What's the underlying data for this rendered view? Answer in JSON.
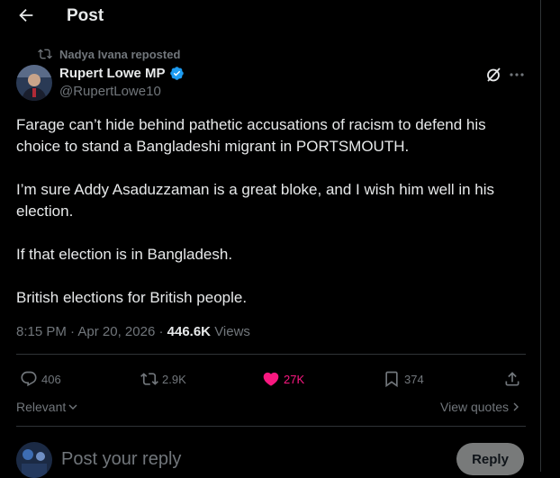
{
  "header": {
    "title": "Post"
  },
  "repost": {
    "text": "Nadya Ivana reposted"
  },
  "author": {
    "name": "Rupert Lowe MP",
    "handle": "@RupertLowe10"
  },
  "tweet": {
    "paragraphs": [
      "Farage can’t hide behind pathetic accusations of racism to defend his choice to stand a Bangladeshi migrant in PORTSMOUTH.",
      "I’m sure Addy Asaduzzaman is a great bloke, and I wish him well in his election.",
      "If that election is in Bangladesh.",
      "British elections for British people."
    ],
    "time": "8:15 PM",
    "date": "Apr 20, 2026",
    "views_count": "446.6K",
    "views_label": "Views"
  },
  "actions": {
    "replies": "406",
    "reposts": "2.9K",
    "likes": "27K",
    "bookmarks": "374"
  },
  "sort": {
    "label": "Relevant"
  },
  "quotes": {
    "label": "View quotes"
  },
  "reply": {
    "placeholder": "Post your reply",
    "button": "Reply"
  },
  "colors": {
    "background": "#000000",
    "text": "#e7e9ea",
    "muted": "#71767b",
    "like": "#f91880",
    "divider": "#2f3336",
    "verified": "#1d9bf0"
  }
}
